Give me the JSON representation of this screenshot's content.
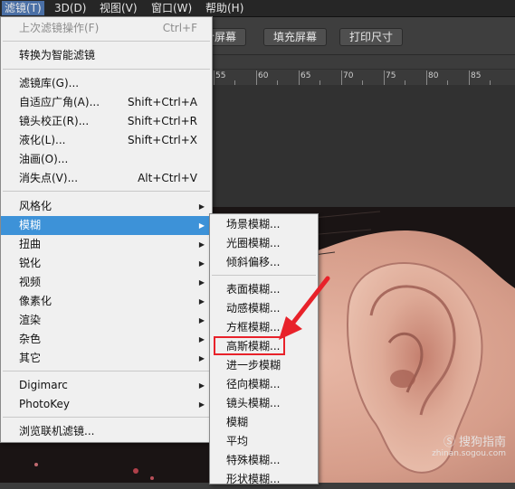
{
  "menubar": {
    "items": [
      "滤镜(T)",
      "3D(D)",
      "视图(V)",
      "窗口(W)",
      "帮助(H)"
    ]
  },
  "optionsbar": {
    "buttons": [
      "合屏幕",
      "填充屏幕",
      "打印尺寸"
    ]
  },
  "ruler": {
    "labels": [
      "55",
      "60",
      "65",
      "70",
      "75",
      "80",
      "85"
    ]
  },
  "filter_menu": {
    "items": [
      {
        "label": "上次滤镜操作(F)",
        "shortcut": "Ctrl+F"
      },
      {
        "label": "转换为智能滤镜",
        "shortcut": ""
      },
      {
        "label": "滤镜库(G)...",
        "shortcut": ""
      },
      {
        "label": "自适应广角(A)...",
        "shortcut": "Shift+Ctrl+A"
      },
      {
        "label": "镜头校正(R)...",
        "shortcut": "Shift+Ctrl+R"
      },
      {
        "label": "液化(L)...",
        "shortcut": "Shift+Ctrl+X"
      },
      {
        "label": "油画(O)...",
        "shortcut": ""
      },
      {
        "label": "消失点(V)...",
        "shortcut": "Alt+Ctrl+V"
      },
      {
        "label": "风格化",
        "shortcut": ""
      },
      {
        "label": "模糊",
        "shortcut": ""
      },
      {
        "label": "扭曲",
        "shortcut": ""
      },
      {
        "label": "锐化",
        "shortcut": ""
      },
      {
        "label": "视频",
        "shortcut": ""
      },
      {
        "label": "像素化",
        "shortcut": ""
      },
      {
        "label": "渲染",
        "shortcut": ""
      },
      {
        "label": "杂色",
        "shortcut": ""
      },
      {
        "label": "其它",
        "shortcut": ""
      },
      {
        "label": "Digimarc",
        "shortcut": ""
      },
      {
        "label": "PhotoKey",
        "shortcut": ""
      },
      {
        "label": "浏览联机滤镜...",
        "shortcut": ""
      }
    ]
  },
  "blur_submenu": {
    "items": [
      "场景模糊...",
      "光圈模糊...",
      "倾斜偏移...",
      "表面模糊...",
      "动感模糊...",
      "方框模糊...",
      "高斯模糊...",
      "进一步模糊",
      "径向模糊...",
      "镜头模糊...",
      "模糊",
      "平均",
      "特殊模糊...",
      "形状模糊..."
    ]
  },
  "watermark": {
    "brand": "搜狗指南",
    "url": "zhinan.sogou.com"
  },
  "colors": {
    "highlight": "#3d92d8",
    "annotation": "#e8222a"
  }
}
